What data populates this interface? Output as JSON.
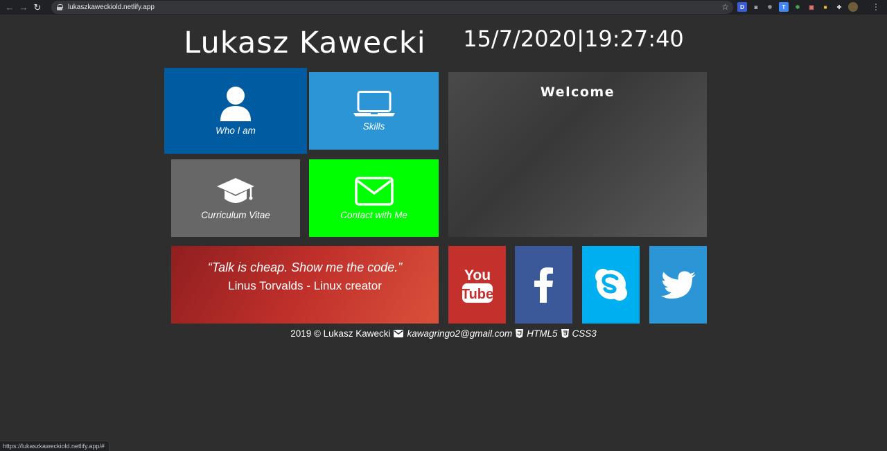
{
  "browser": {
    "url": "lukaszkaweckiold.netlify.app",
    "status_url": "https://lukaszkaweckiold.netlify.app/#"
  },
  "header": {
    "name": "Lukasz Kawecki",
    "datetime": "15/7/2020|19:27:40"
  },
  "tiles": {
    "who": "Who I am",
    "skills": "Skills",
    "cv": "Curriculum Vitae",
    "contact": "Contact with Me"
  },
  "welcome": {
    "title": "Welcome"
  },
  "quote": {
    "text": "“Talk is cheap. Show me the code.”",
    "author": "Linus Torvalds - Linux creator"
  },
  "social": {
    "youtube_top": "You",
    "youtube_bottom": "Tube"
  },
  "footer": {
    "copyright": "2019 © Lukasz Kawecki",
    "email": "kawagringo2@gmail.com",
    "html": "HTML5",
    "css": "CSS3"
  },
  "colors": {
    "background": "#2e2e2e",
    "who": "#005ba1",
    "skills": "#2b95d6",
    "cv": "#676767",
    "contact": "#00ff00",
    "youtube": "#c4302b",
    "facebook": "#3b5998",
    "skype": "#00aff0",
    "twitter": "#2b95d6"
  }
}
